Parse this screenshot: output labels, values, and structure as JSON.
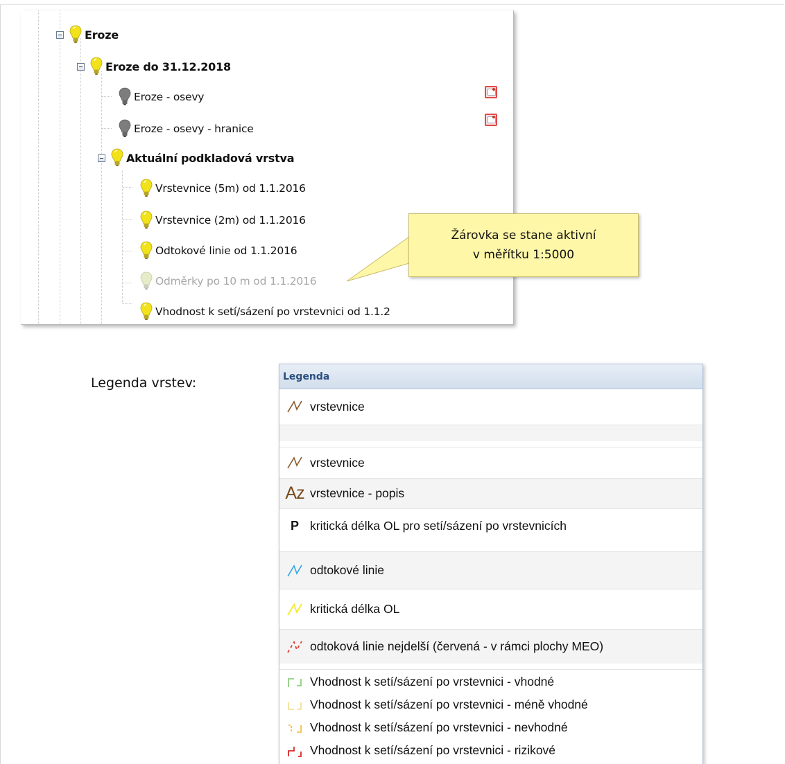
{
  "tree": {
    "items": [
      {
        "label": "Eroze",
        "bold": true,
        "bulb": "lightbulb-on-icon"
      },
      {
        "label": "Eroze do 31.12.2018",
        "bold": true,
        "bulb": "lightbulb-on-icon"
      },
      {
        "label": "Eroze - osevy",
        "bold": false,
        "bulb": "lightbulb-off-icon",
        "action": "layer-properties-icon"
      },
      {
        "label": "Eroze - osevy - hranice",
        "bold": false,
        "bulb": "lightbulb-off-icon",
        "action": "layer-properties-icon"
      },
      {
        "label": "Aktuální podkladová vrstva",
        "bold": true,
        "bulb": "lightbulb-on-icon"
      },
      {
        "label": "Vrstevnice (5m) od 1.1.2016",
        "bold": false,
        "bulb": "lightbulb-on-icon"
      },
      {
        "label": "Vrstevnice (2m) od 1.1.2016",
        "bold": false,
        "bulb": "lightbulb-on-icon"
      },
      {
        "label": "Odtokové linie od 1.1.2016",
        "bold": false,
        "bulb": "lightbulb-on-icon"
      },
      {
        "label": "Odměrky po 10 m od 1.1.2016",
        "bold": false,
        "bulb": "lightbulb-inactive-icon"
      },
      {
        "label": "Vhodnost k setí/sázení po vrstevnici od 1.1.2",
        "bold": false,
        "bulb": "lightbulb-on-icon"
      }
    ]
  },
  "callout": {
    "line1": "Žárovka se stane aktivní",
    "line2": "v měřítku 1:5000"
  },
  "legend": {
    "caption": "Legenda vrstev:",
    "title": "Legenda",
    "items": [
      {
        "icon": "brown-line-icon",
        "label": "vrstevnice"
      },
      {
        "icon": "brown-line-icon",
        "label": "vrstevnice"
      },
      {
        "icon": "az-text-icon",
        "glyph": "Az",
        "label": "vrstevnice - popis"
      },
      {
        "icon": "p-text-icon",
        "glyph": "P",
        "label": "kritická délka OL pro setí/sázení po vrstevnicích"
      },
      {
        "icon": "blue-line-icon",
        "label": "odtokové linie"
      },
      {
        "icon": "yellow-line-icon",
        "label": "kritická délka OL"
      },
      {
        "icon": "red-dashed-line-icon",
        "label": "odtoková linie nejdelší (červená - v rámci plochy MEO)"
      },
      {
        "icon": "green-step-line-icon",
        "label": "Vhodnost k setí/sázení po vrstevnici - vhodné"
      },
      {
        "icon": "lightyellow-step-line-icon",
        "label": "Vhodnost k setí/sázení po vrstevnici - méně vhodné"
      },
      {
        "icon": "orange-step-line-icon",
        "label": "Vhodnost k setí/sázení po vrstevnici - nevhodné"
      },
      {
        "icon": "red-step-line-icon",
        "label": "Vhodnost k setí/sázení po vrstevnici - rizikové"
      }
    ]
  },
  "colors": {
    "bulb_on": "#f2e21a",
    "bulb_off": "#7d7d7d",
    "bulb_inactive": "#dfe6c0",
    "contour_brown": "#8a5a2b",
    "runoff_blue": "#2fa6e6",
    "critical_yellow": "#f3ea2c",
    "longest_red": "#e03a2a",
    "suit_green": "#8ccf7c",
    "suit_lightyellow": "#efe39a",
    "suit_orange": "#f2c050",
    "suit_red": "#d62a2a",
    "legend_title": "#2b4f7e",
    "callout_bg": "#fff7a8"
  }
}
